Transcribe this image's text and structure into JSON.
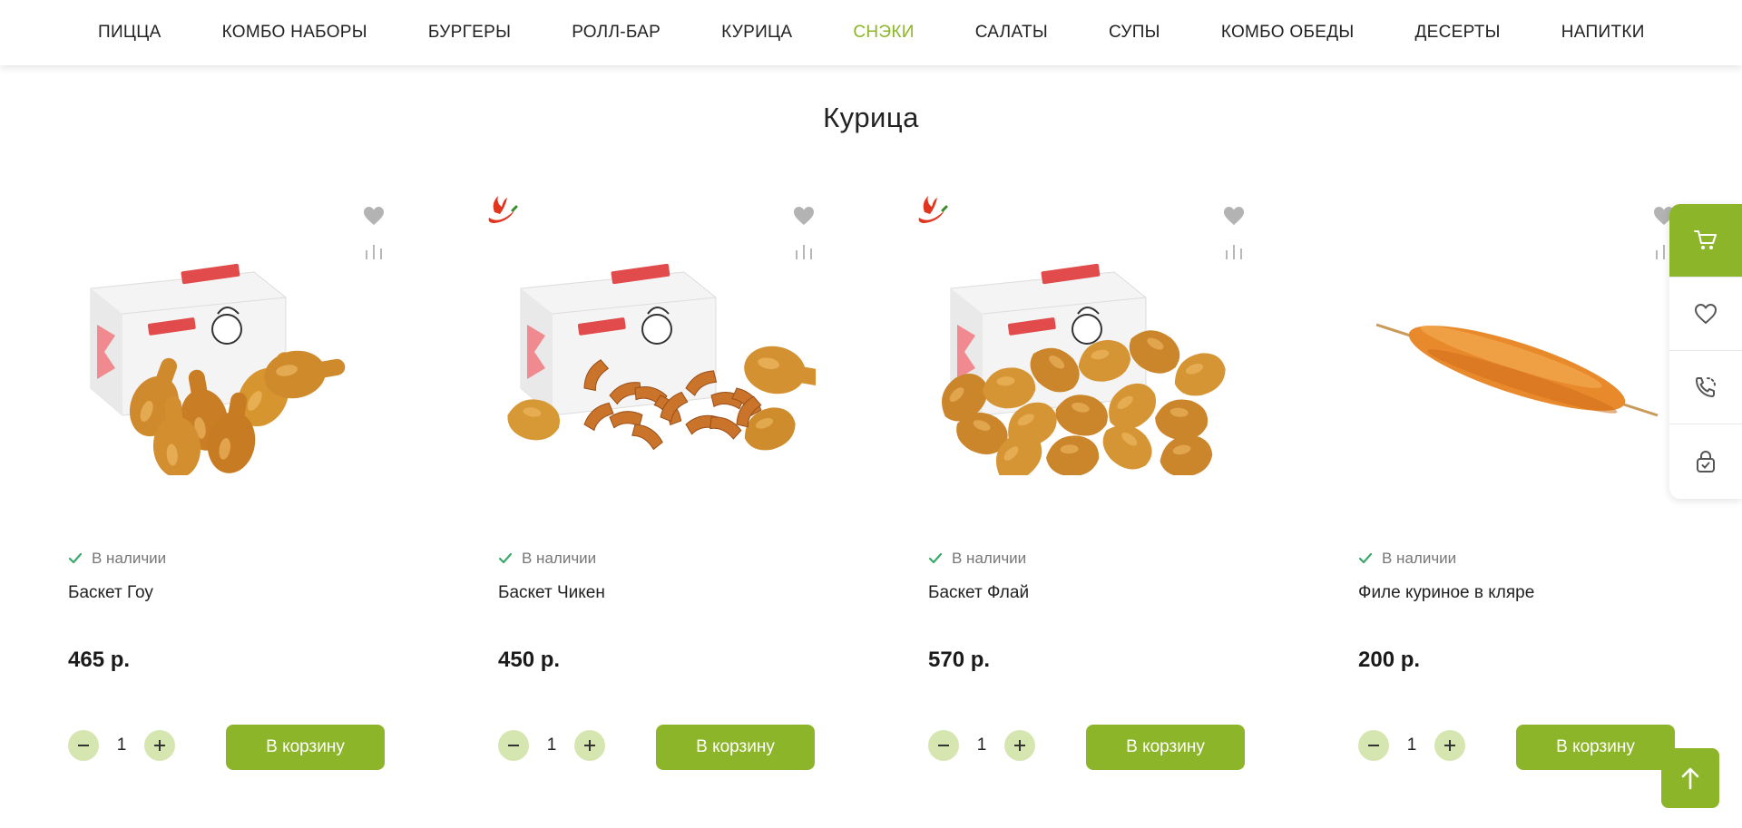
{
  "nav": {
    "items": [
      {
        "label": "ПИЦЦА"
      },
      {
        "label": "КОМБО НАБОРЫ"
      },
      {
        "label": "БУРГЕРЫ"
      },
      {
        "label": "РОЛЛ-БАР"
      },
      {
        "label": "КУРИЦА"
      },
      {
        "label": "СНЭКИ",
        "active": true
      },
      {
        "label": "САЛАТЫ"
      },
      {
        "label": "СУПЫ"
      },
      {
        "label": "КОМБО ОБЕДЫ"
      },
      {
        "label": "ДЕСЕРТЫ"
      },
      {
        "label": "НАПИТКИ"
      }
    ]
  },
  "section": {
    "title": "Курица"
  },
  "products": [
    {
      "name": "Баскет Гоу",
      "price": "465 р.",
      "stock": "В наличии",
      "qty": "1",
      "cart_label": "В корзину",
      "hot": false,
      "image": "chicken-box-drumsticks"
    },
    {
      "name": "Баскет Чикен",
      "price": "450 р.",
      "stock": "В наличии",
      "qty": "1",
      "cart_label": "В корзину",
      "hot": true,
      "image": "chicken-box-wedges"
    },
    {
      "name": "Баскет Флай",
      "price": "570 р.",
      "stock": "В наличии",
      "qty": "1",
      "cart_label": "В корзину",
      "hot": true,
      "image": "chicken-box-wings"
    },
    {
      "name": "Филе куриное в кляре",
      "price": "200 р.",
      "stock": "В наличии",
      "qty": "1",
      "cart_label": "В корзину",
      "hot": false,
      "image": "battered-fillet-skewer"
    }
  ],
  "sidebar": {
    "icons": [
      "cart-icon",
      "heart-icon",
      "phone-icon",
      "lock-icon"
    ]
  },
  "colors": {
    "accent": "#8db52a",
    "accent_light": "#d6e6b0",
    "stock_check": "#3aa86b",
    "hot": "#e0351f"
  }
}
